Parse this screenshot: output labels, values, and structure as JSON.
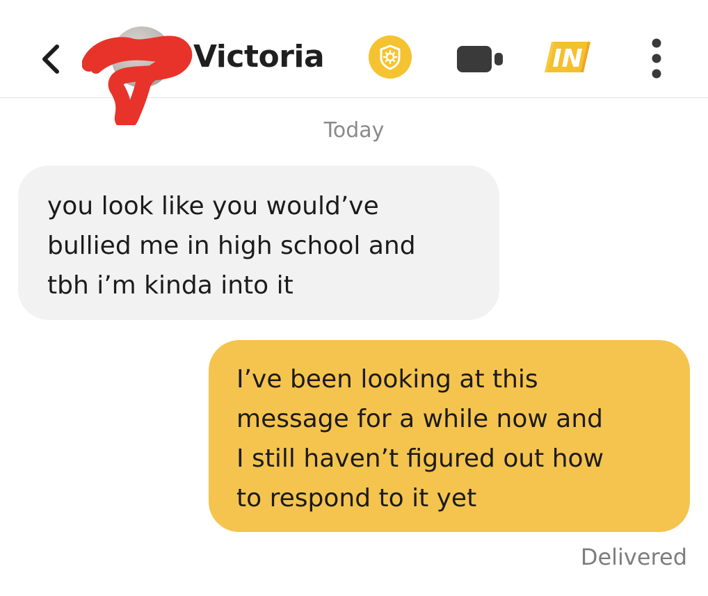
{
  "header": {
    "back_icon": "chevron-left-icon",
    "contact_name": "Victoria",
    "badge_icon": "verification-badge-icon",
    "video_icon": "video-camera-icon",
    "in_label": "IN",
    "more_icon": "more-vertical-icon",
    "accent_color": "#f5c330"
  },
  "conversation": {
    "day_label": "Today",
    "messages": [
      {
        "direction": "incoming",
        "lines": [
          "you look like you would’ve",
          "bullied me in high school and",
          "tbh i’m kinda into it"
        ]
      },
      {
        "direction": "outgoing",
        "lines": [
          "I’ve been looking at this",
          "message for a while now and",
          "I still haven’t figured out how",
          "to respond to it yet"
        ]
      }
    ],
    "status": "Delivered"
  },
  "colors": {
    "incoming_bubble": "#f2f2f2",
    "outgoing_bubble": "#f5c44e",
    "redaction_scribble": "#e8332a"
  }
}
